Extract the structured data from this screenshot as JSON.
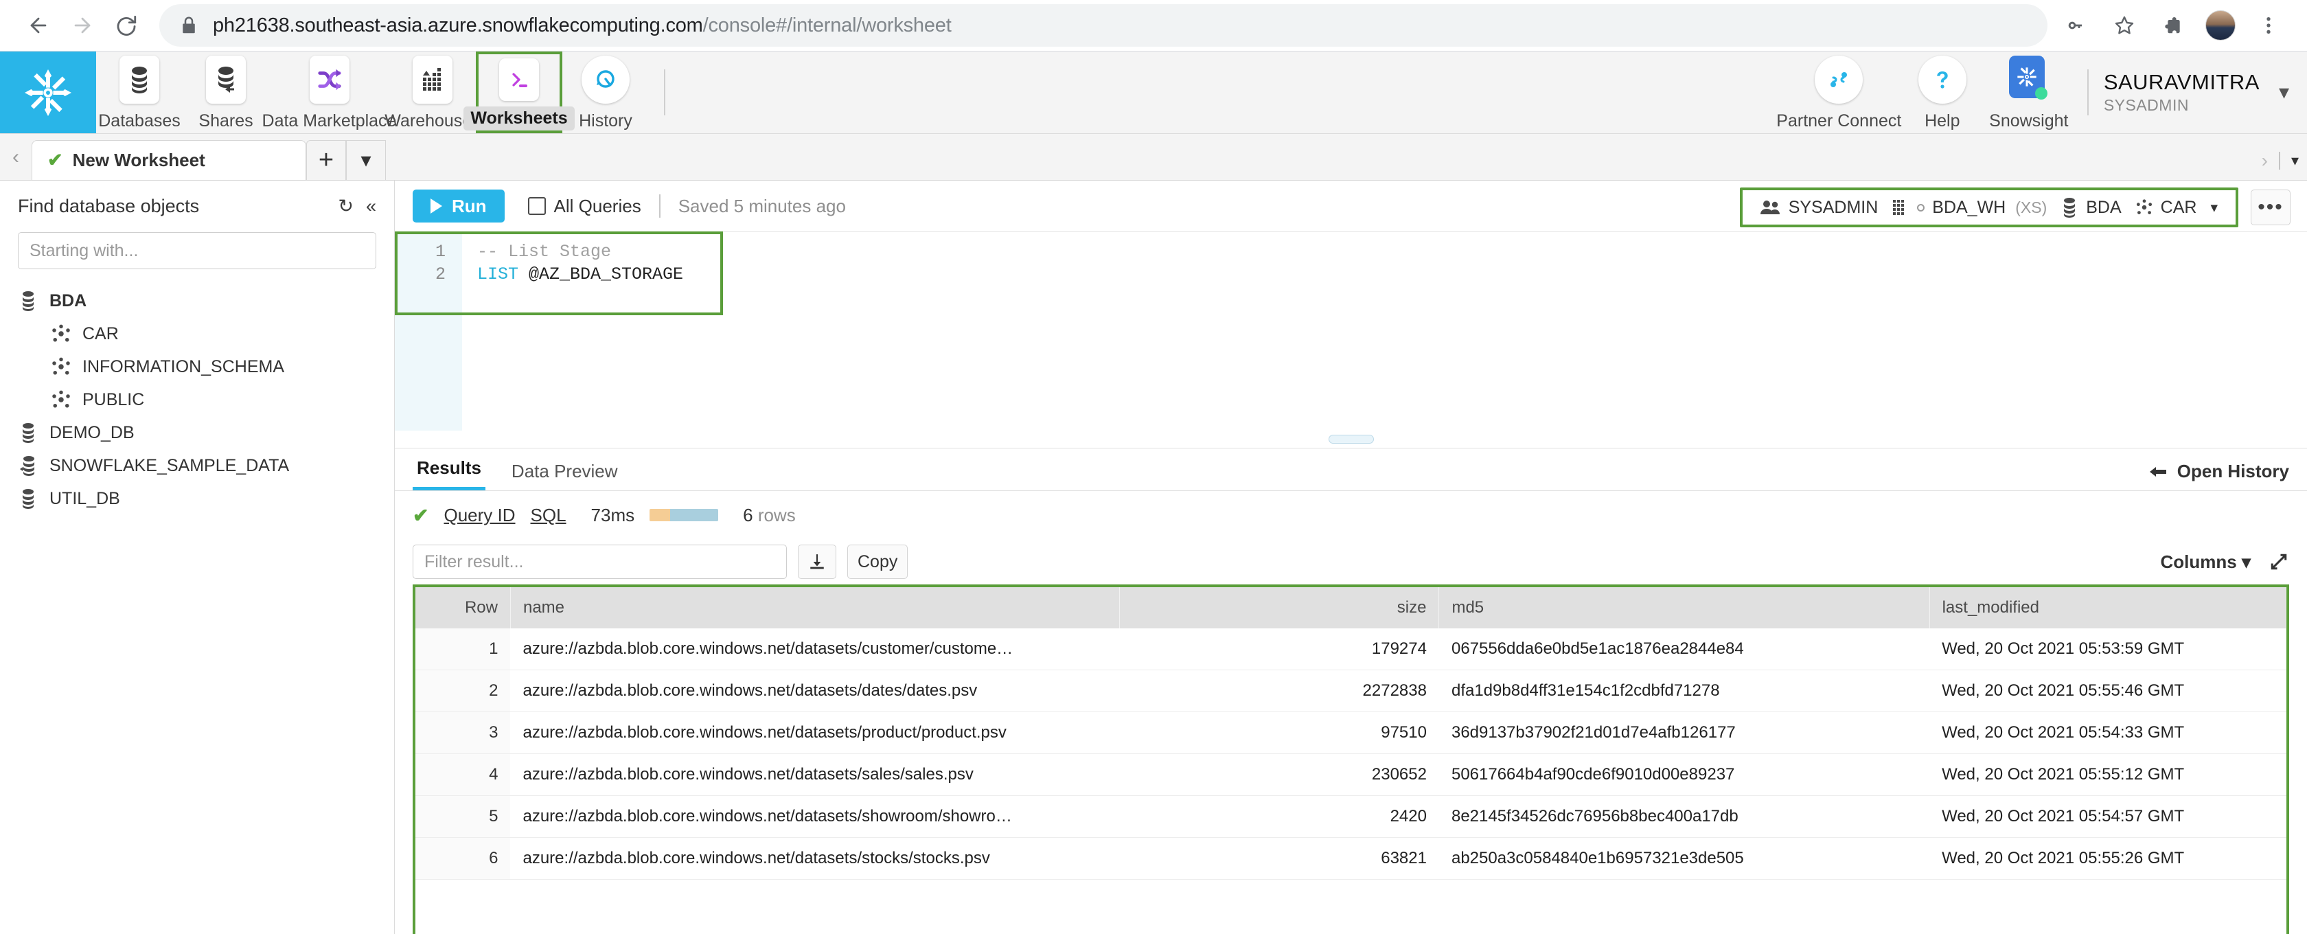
{
  "browser": {
    "url_host": "ph21638.southeast-asia.azure.snowflakecomputing.com",
    "url_path": "/console#/internal/worksheet",
    "back_title": "Back",
    "forward_title": "Forward",
    "reload_title": "Reload",
    "lock_title": "View site information",
    "key_title": "Saved passwords",
    "star_title": "Bookmark this tab",
    "extensions_title": "Extensions",
    "profile_title": "Profile",
    "menu_title": "Customize and control Google Chrome"
  },
  "topnav": {
    "logo_alt": "Snowflake",
    "items": [
      {
        "label": "Databases",
        "icon": "databases-icon"
      },
      {
        "label": "Shares",
        "icon": "shares-icon"
      },
      {
        "label": "Data Marketplace",
        "icon": "data-marketplace-icon"
      },
      {
        "label": "Warehouses",
        "icon": "warehouses-icon"
      },
      {
        "label": "Worksheets",
        "icon": "worksheets-icon"
      },
      {
        "label": "History",
        "icon": "history-icon"
      }
    ],
    "right_items": [
      {
        "label": "Partner Connect",
        "icon": "partner-connect-icon"
      },
      {
        "label": "Help",
        "icon": "help-icon"
      },
      {
        "label": "Snowsight",
        "icon": "snowsight-icon"
      }
    ],
    "user": "SAURAVMITRA",
    "role": "SYSADMIN"
  },
  "tabstrip": {
    "worksheet_name": "New Worksheet",
    "add_label": "+",
    "dropdown_label": "▾",
    "scroll_left": "‹",
    "scroll_right": "›"
  },
  "sidebar": {
    "title": "Find database objects",
    "refresh_icon": "refresh-icon",
    "collapse_icon": "collapse-icon",
    "search_placeholder": "Starting with...",
    "search_value": "",
    "tree": [
      {
        "label": "BDA",
        "type": "database",
        "level": 1,
        "bold": true
      },
      {
        "label": "CAR",
        "type": "schema",
        "level": 2,
        "bold": false
      },
      {
        "label": "INFORMATION_SCHEMA",
        "type": "schema",
        "level": 2,
        "bold": false
      },
      {
        "label": "PUBLIC",
        "type": "schema",
        "level": 2,
        "bold": false
      },
      {
        "label": "DEMO_DB",
        "type": "database",
        "level": 1,
        "bold": false
      },
      {
        "label": "SNOWFLAKE_SAMPLE_DATA",
        "type": "shared-database",
        "level": 1,
        "bold": false
      },
      {
        "label": "UTIL_DB",
        "type": "database",
        "level": 1,
        "bold": false
      }
    ]
  },
  "runbar": {
    "run_label": "Run",
    "all_queries_label": "All Queries",
    "all_queries_checked": false,
    "saved_label": "Saved 5 minutes ago"
  },
  "context": {
    "role": "SYSADMIN",
    "warehouse": "BDA_WH",
    "warehouse_size": "(XS)",
    "database": "BDA",
    "schema": "CAR",
    "caret": "▾",
    "more_label": "•••"
  },
  "editor": {
    "lines": [
      {
        "no": "1",
        "text": "-- List Stage",
        "kind": "comment"
      },
      {
        "no": "2",
        "keyword": "LIST",
        "text": " @AZ_BDA_STORAGE",
        "kind": "sql"
      }
    ]
  },
  "results": {
    "tabs": [
      {
        "label": "Results",
        "active": true
      },
      {
        "label": "Data Preview",
        "active": false
      }
    ],
    "open_history_label": "Open History",
    "status_icon": "success-check-icon",
    "query_id_label": "Query ID",
    "sql_label": "SQL",
    "duration": "73ms",
    "row_count": "6",
    "rows_word": "rows",
    "filter_placeholder": "Filter result...",
    "filter_value": "",
    "download_icon": "download-icon",
    "copy_label": "Copy",
    "columns_label": "Columns",
    "expand_icon": "expand-icon",
    "columns": [
      "Row",
      "name",
      "size",
      "md5",
      "last_modified"
    ],
    "rows": [
      {
        "row": "1",
        "name": "azure://azbda.blob.core.windows.net/datasets/customer/custome…",
        "size": "179274",
        "md5": "067556dda6e0bd5e1ac1876ea2844e84",
        "last_modified": "Wed, 20 Oct 2021 05:53:59 GMT"
      },
      {
        "row": "2",
        "name": "azure://azbda.blob.core.windows.net/datasets/dates/dates.psv",
        "size": "2272838",
        "md5": "dfa1d9b8d4ff31e154c1f2cdbfd71278",
        "last_modified": "Wed, 20 Oct 2021 05:55:46 GMT"
      },
      {
        "row": "3",
        "name": "azure://azbda.blob.core.windows.net/datasets/product/product.psv",
        "size": "97510",
        "md5": "36d9137b37902f21d01d7e4afb126177",
        "last_modified": "Wed, 20 Oct 2021 05:54:33 GMT"
      },
      {
        "row": "4",
        "name": "azure://azbda.blob.core.windows.net/datasets/sales/sales.psv",
        "size": "230652",
        "md5": "50617664b4af90cde6f9010d00e89237",
        "last_modified": "Wed, 20 Oct 2021 05:55:12 GMT"
      },
      {
        "row": "5",
        "name": "azure://azbda.blob.core.windows.net/datasets/showroom/showro…",
        "size": "2420",
        "md5": "8e2145f34526dc76956b8bec400a17db",
        "last_modified": "Wed, 20 Oct 2021 05:54:57 GMT"
      },
      {
        "row": "6",
        "name": "azure://azbda.blob.core.windows.net/datasets/stocks/stocks.psv",
        "size": "63821",
        "md5": "ab250a3c0584840e1b6957321e3de505",
        "last_modified": "Wed, 20 Oct 2021 05:55:26 GMT"
      }
    ]
  },
  "colors": {
    "snowflake_blue": "#29b5e8",
    "highlight_green": "#5a9e3a",
    "success_green": "#5aa83c",
    "snowsight_blue": "#3b7ddd"
  }
}
